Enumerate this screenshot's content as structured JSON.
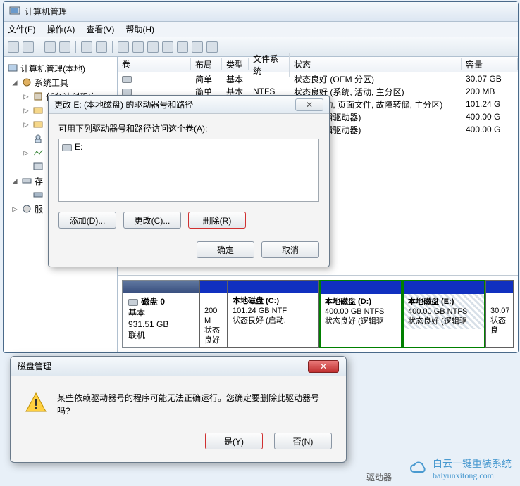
{
  "window": {
    "title": "计算机管理"
  },
  "menubar": {
    "file": "文件(F)",
    "action": "操作(A)",
    "view": "查看(V)",
    "help": "帮助(H)"
  },
  "tree": {
    "root": "计算机管理(本地)",
    "sys_tools": "系统工具",
    "task_scheduler": "任务计划程序",
    "storage_partial": "存",
    "services_partial": "服"
  },
  "vol_header": {
    "volume": "卷",
    "layout": "布局",
    "type": "类型",
    "filesystem": "文件系统",
    "status": "状态",
    "capacity": "容量"
  },
  "volumes": [
    {
      "vol": "",
      "layout": "简单",
      "type": "基本",
      "fs": "",
      "status": "状态良好 (OEM 分区)",
      "cap": "30.07 GB"
    },
    {
      "vol": "",
      "layout": "简单",
      "type": "基本",
      "fs": "NTFS",
      "status": "状态良好 (系统, 活动, 主分区)",
      "cap": "200 MB"
    },
    {
      "vol": "",
      "layout": "",
      "type": "",
      "fs": "",
      "status": "良好 (启动, 页面文件, 故障转储, 主分区)",
      "cap": "101.24 G"
    },
    {
      "vol": "",
      "layout": "",
      "type": "",
      "fs": "",
      "status": "良好 (逻辑驱动器)",
      "cap": "400.00 G"
    },
    {
      "vol": "",
      "layout": "",
      "type": "",
      "fs": "",
      "status": "良好 (逻辑驱动器)",
      "cap": "400.00 G"
    }
  ],
  "disk": {
    "label": "磁盘 0",
    "type": "基本",
    "size": "931.51 GB",
    "state": "联机",
    "parts": [
      {
        "name": "",
        "size": "200 M",
        "status": "状态良好"
      },
      {
        "name": "本地磁盘  (C:)",
        "size": "101.24 GB NTF",
        "status": "状态良好 (启动,"
      },
      {
        "name": "本地磁盘  (D:)",
        "size": "400.00 GB NTFS",
        "status": "状态良好 (逻辑驱"
      },
      {
        "name": "本地磁盘  (E:)",
        "size": "400.00 GB NTFS",
        "status": "状态良好 (逻辑驱"
      },
      {
        "name": "",
        "size": "30.07",
        "status": "状态良"
      }
    ]
  },
  "dlg": {
    "title": "更改 E: (本地磁盘) 的驱动器号和路径",
    "prompt": "可用下列驱动器号和路径访问这个卷(A):",
    "drive_entry": "E:",
    "add": "添加(D)...",
    "change": "更改(C)...",
    "remove": "删除(R)",
    "ok": "确定",
    "cancel": "取消"
  },
  "confirm": {
    "title": "磁盘管理",
    "msg": "某些依赖驱动器号的程序可能无法正确运行。您确定要删除此驱动器号吗?",
    "yes": "是(Y)",
    "no": "否(N)"
  },
  "footer": {
    "drv_label": "驱动器"
  },
  "watermark": {
    "brand": "白云一键重装系统",
    "url": "baiyunxitong.com"
  }
}
